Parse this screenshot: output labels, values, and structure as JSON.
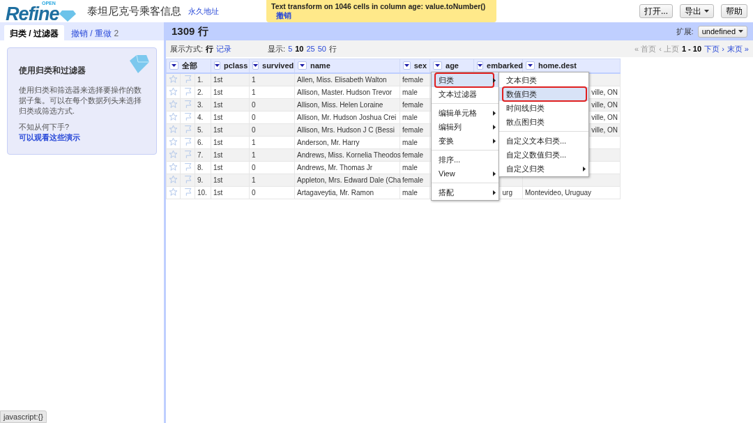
{
  "header": {
    "logo_small": "OPEN",
    "logo": "Refine",
    "project_title": "泰坦尼克号乘客信息",
    "permalink": "永久地址",
    "buttons": [
      {
        "label": "打开...",
        "caret": false
      },
      {
        "label": "导出",
        "caret": true
      },
      {
        "label": "帮助",
        "caret": false
      }
    ]
  },
  "notification": {
    "message": "Text transform on 1046 cells in column age: value.toNumber()",
    "undo": "撤销"
  },
  "left_tabs": [
    {
      "label": "归类 / 过滤器",
      "selected": true
    },
    {
      "label": "撤销 / 重做",
      "count": "2",
      "selected": false
    }
  ],
  "help_card": {
    "title": "使用归类和过滤器",
    "body": "使用归类和筛选器来选择要操作的数据子集。可以在每个数据列头来选择归类或筛选方式.",
    "question": "不知从何下手?",
    "link": "可以观看这些演示"
  },
  "summary": {
    "rows": "1309 行",
    "extension_label": "扩展:",
    "extension_value": "undefined"
  },
  "view_bar": {
    "show_as_label": "展示方式:",
    "modes": [
      {
        "label": "行",
        "selected": true
      },
      {
        "label": "记录",
        "selected": false
      }
    ],
    "page_size_label": "显示:",
    "page_sizes": [
      {
        "label": "5",
        "selected": false
      },
      {
        "label": "10",
        "selected": true
      },
      {
        "label": "25",
        "selected": false
      },
      {
        "label": "50",
        "selected": false
      }
    ],
    "page_size_unit": "行",
    "pager": [
      {
        "label": "« 首页",
        "disabled": true
      },
      {
        "label": "‹ 上页",
        "disabled": true
      },
      {
        "label": "1 - 10",
        "kind": "current"
      },
      {
        "label": "下页 ›",
        "disabled": false
      },
      {
        "label": "末页 »",
        "disabled": false
      }
    ]
  },
  "table": {
    "columns": [
      "全部",
      "pclass",
      "survived",
      "name",
      "sex",
      "age",
      "embarked",
      "home.dest"
    ],
    "rows": [
      {
        "index": "1.",
        "starred": false,
        "flagged": false,
        "pclass": "1st",
        "survived": "1",
        "name": "Allen, Miss. Elisabeth Walton",
        "sex": "female"
      },
      {
        "index": "2.",
        "starred": false,
        "flagged": false,
        "pclass": "1st",
        "survived": "1",
        "name": "Allison, Master. Hudson Trevor",
        "sex": "male",
        "home_dest": "ville, ON"
      },
      {
        "index": "3.",
        "starred": false,
        "flagged": false,
        "pclass": "1st",
        "survived": "0",
        "name": "Allison, Miss. Helen Loraine",
        "sex": "female",
        "home_dest": "ville, ON"
      },
      {
        "index": "4.",
        "starred": false,
        "flagged": false,
        "pclass": "1st",
        "survived": "0",
        "name": "Allison, Mr. Hudson Joshua Crei",
        "sex": "male",
        "home_dest": "ville, ON"
      },
      {
        "index": "5.",
        "starred": false,
        "flagged": false,
        "pclass": "1st",
        "survived": "0",
        "name": "Allison, Mrs. Hudson J C (Bessi",
        "sex": "female",
        "home_dest": "ville, ON"
      },
      {
        "index": "6.",
        "starred": false,
        "flagged": false,
        "pclass": "1st",
        "survived": "1",
        "name": "Anderson, Mr. Harry",
        "sex": "male"
      },
      {
        "index": "7.",
        "starred": false,
        "flagged": false,
        "pclass": "1st",
        "survived": "1",
        "name": "Andrews, Miss. Kornelia Theodos",
        "sex": "female"
      },
      {
        "index": "8.",
        "starred": false,
        "flagged": false,
        "pclass": "1st",
        "survived": "0",
        "name": "Andrews, Mr. Thomas Jr",
        "sex": "male"
      },
      {
        "index": "9.",
        "starred": false,
        "flagged": false,
        "pclass": "1st",
        "survived": "1",
        "name": "Appleton, Mrs. Edward Dale (Cha",
        "sex": "female"
      },
      {
        "index": "10.",
        "starred": false,
        "flagged": false,
        "pclass": "1st",
        "survived": "0",
        "name": "Artagaveytia, Mr. Ramon",
        "sex": "male",
        "embarked": "urg",
        "home_dest": "Montevideo, Uruguay"
      }
    ]
  },
  "column_menu": {
    "items": [
      {
        "kind": "item",
        "label": "归类",
        "submenu": true,
        "selected": true
      },
      {
        "kind": "item",
        "label": "文本过滤器",
        "submenu": false,
        "selected": false
      },
      {
        "kind": "separator"
      },
      {
        "kind": "item",
        "label": "编辑单元格",
        "submenu": true,
        "selected": false
      },
      {
        "kind": "item",
        "label": "编辑列",
        "submenu": true,
        "selected": false
      },
      {
        "kind": "item",
        "label": "变换",
        "submenu": true,
        "selected": false
      },
      {
        "kind": "separator"
      },
      {
        "kind": "item",
        "label": "排序...",
        "submenu": false,
        "selected": false
      },
      {
        "kind": "item",
        "label": "View",
        "submenu": true,
        "selected": false
      },
      {
        "kind": "separator"
      },
      {
        "kind": "item",
        "label": "搭配",
        "submenu": true,
        "selected": false
      }
    ],
    "submenu": [
      {
        "kind": "item",
        "label": "文本归类",
        "submenu": false,
        "selected": false
      },
      {
        "kind": "item",
        "label": "数值归类",
        "submenu": false,
        "selected": true
      },
      {
        "kind": "item",
        "label": "时间线归类",
        "submenu": false,
        "selected": false
      },
      {
        "kind": "item",
        "label": "散点图归类",
        "submenu": false,
        "selected": false
      },
      {
        "kind": "separator"
      },
      {
        "kind": "item",
        "label": "自定义文本归类...",
        "submenu": false,
        "selected": false
      },
      {
        "kind": "item",
        "label": "自定义数值归类...",
        "submenu": false,
        "selected": false
      },
      {
        "kind": "item",
        "label": "自定义归类",
        "submenu": true,
        "selected": false
      }
    ]
  },
  "status_bar": "javascript:{}"
}
